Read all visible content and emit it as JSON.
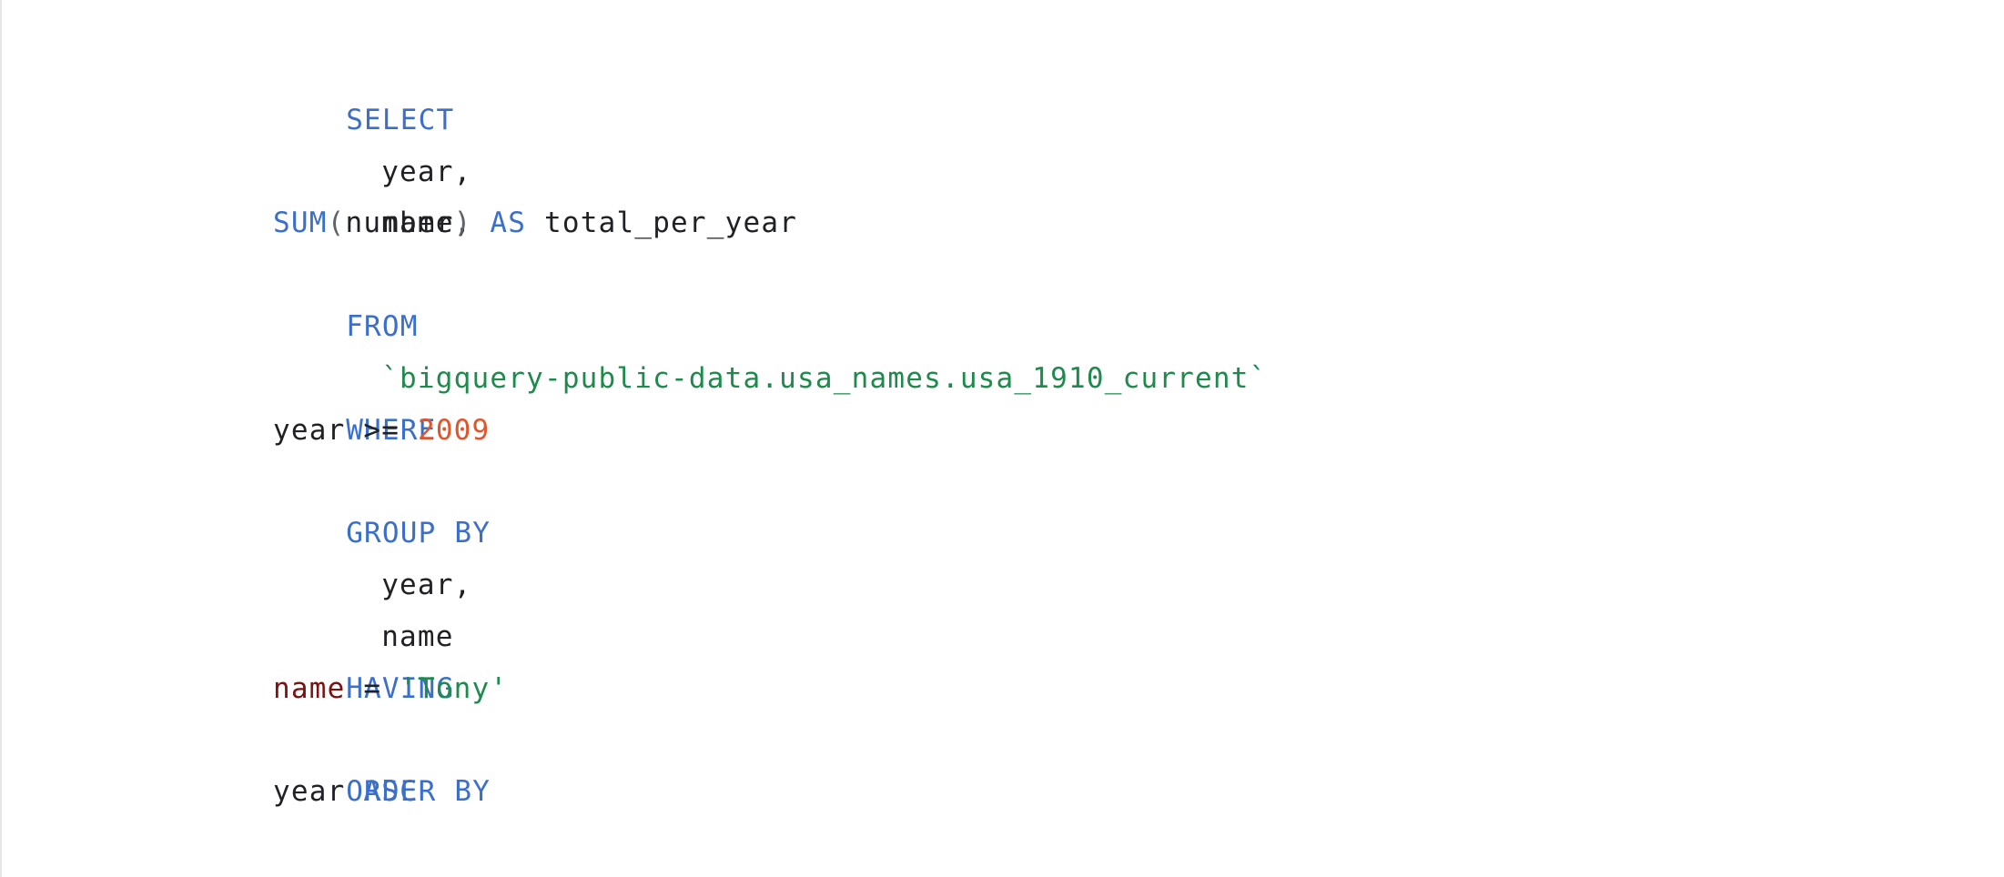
{
  "editor": {
    "lines": [
      {
        "tokens": [
          {
            "type": "kw",
            "text": "SELECT"
          }
        ]
      },
      {
        "tokens": [
          {
            "type": "plain",
            "text": "year,"
          }
        ]
      },
      {
        "tokens": [
          {
            "type": "plain",
            "text": "name,"
          }
        ]
      },
      {
        "tokens": [
          {
            "type": "fn",
            "text": "SUM"
          },
          {
            "type": "punc",
            "text": "("
          },
          {
            "type": "plain",
            "text": "number"
          },
          {
            "type": "punc",
            "text": ")"
          },
          {
            "type": "kw",
            "text": "AS"
          },
          {
            "type": "plain",
            "text": "total_per_year"
          }
        ]
      },
      {
        "tokens": [
          {
            "type": "kw",
            "text": "FROM"
          }
        ]
      },
      {
        "tokens": [
          {
            "type": "str",
            "text": "`bigquery-public-data.usa_names.usa_1910_current`"
          }
        ]
      },
      {
        "tokens": [
          {
            "type": "kw",
            "text": "WHERE"
          }
        ]
      },
      {
        "tokens": [
          {
            "type": "plain",
            "text": "year"
          },
          {
            "type": "plain",
            "text": ">="
          },
          {
            "type": "num",
            "text": "2009"
          }
        ]
      },
      {
        "tokens": [
          {
            "type": "kw",
            "text": "GROUP BY"
          }
        ]
      },
      {
        "tokens": [
          {
            "type": "plain",
            "text": "year,"
          }
        ]
      },
      {
        "tokens": [
          {
            "type": "plain",
            "text": "name"
          }
        ]
      },
      {
        "tokens": [
          {
            "type": "kw",
            "text": "HAVING"
          }
        ]
      },
      {
        "tokens": [
          {
            "type": "col",
            "text": "name"
          },
          {
            "type": "plain",
            "text": "="
          },
          {
            "type": "str",
            "text": "'Tony'"
          }
        ]
      },
      {
        "tokens": [
          {
            "type": "kw",
            "text": "ORDER BY"
          }
        ]
      },
      {
        "tokens": [
          {
            "type": "plain",
            "text": "year"
          },
          {
            "type": "kw",
            "text": "ASC"
          }
        ]
      }
    ]
  },
  "colors": {
    "keyword": "#3b6fc9",
    "string": "#1e8a4c",
    "number": "#e2552a",
    "column": "#7a1212",
    "text": "#202124",
    "background": "#ffffff"
  }
}
